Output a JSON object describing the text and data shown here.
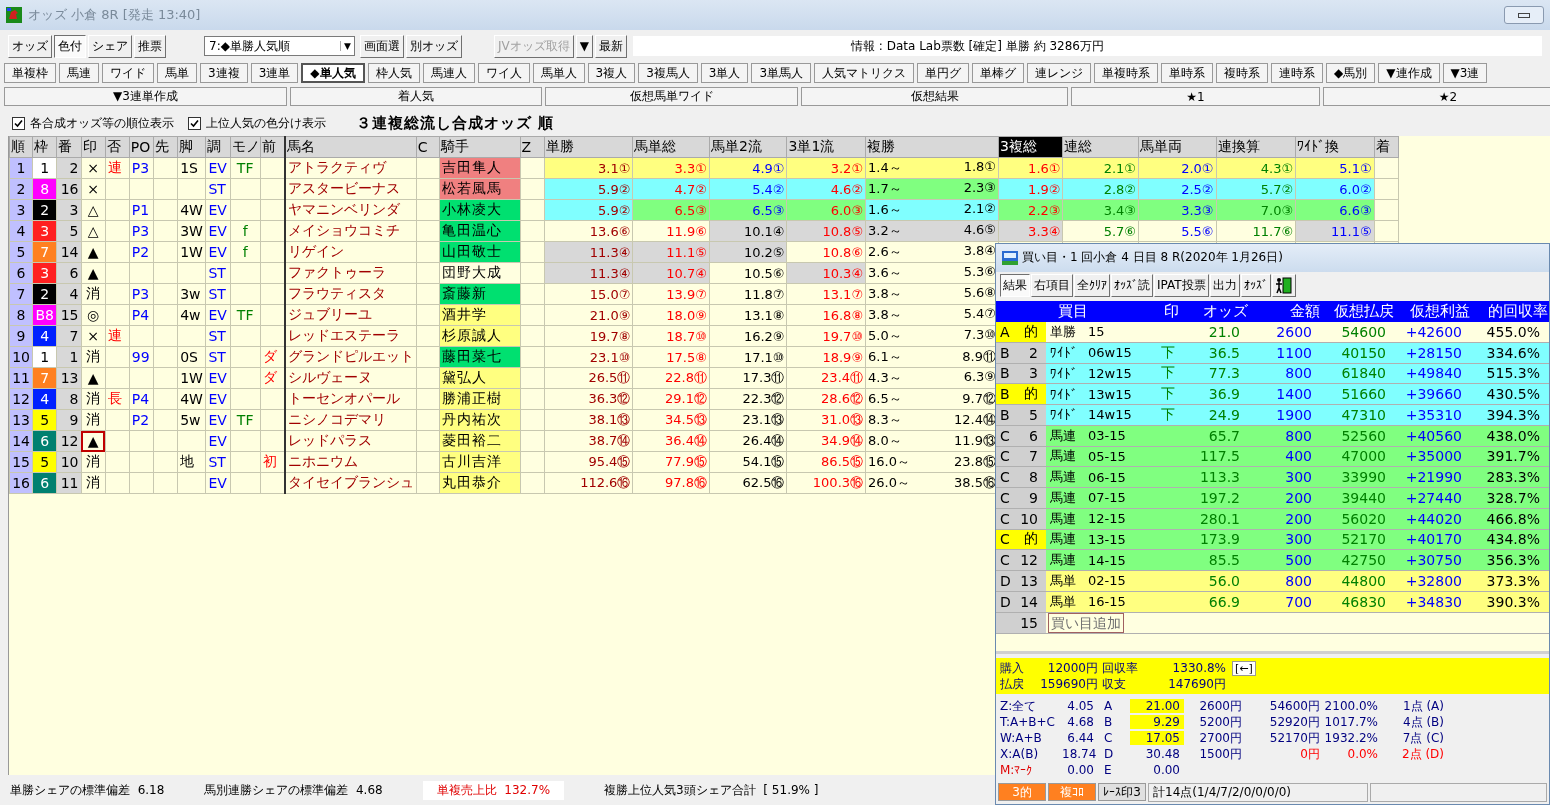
{
  "window": {
    "title": "オッズ 小倉 8R [発走 13:40]"
  },
  "toolbar": {
    "modes": [
      {
        "label": "オッズ",
        "selected": false
      },
      {
        "label": "色付",
        "selected": true
      },
      {
        "label": "シェア",
        "selected": false
      },
      {
        "label": "推票",
        "selected": false
      }
    ],
    "sort_select": {
      "value": "7:◆単勝人気順",
      "arrow": "▼"
    },
    "buttons": [
      {
        "label": "画面選",
        "disabled": false
      },
      {
        "label": "別オッズ",
        "disabled": false
      },
      {
        "label": "JVオッズ取得",
        "disabled": true
      },
      {
        "label": "▼",
        "disabled": false
      },
      {
        "label": "最新",
        "disabled": false
      }
    ],
    "info": "情報 : Data Lab票数 [確定] 単勝 約 3286万円"
  },
  "views": [
    {
      "label": "単複枠",
      "selected": false
    },
    {
      "label": "馬連",
      "selected": false
    },
    {
      "label": "ワイド",
      "selected": false
    },
    {
      "label": "馬単",
      "selected": false
    },
    {
      "label": "3連複",
      "selected": false
    },
    {
      "label": "3連単",
      "selected": false
    },
    {
      "label": "◆単人気",
      "selected": true
    },
    {
      "label": "枠人気",
      "selected": false
    },
    {
      "label": "馬連人",
      "selected": false
    },
    {
      "label": "ワイ人",
      "selected": false
    },
    {
      "label": "馬単人",
      "selected": false
    },
    {
      "label": "3複人",
      "selected": false
    },
    {
      "label": "3複馬人",
      "selected": false
    },
    {
      "label": "3単人",
      "selected": false
    },
    {
      "label": "3単馬人",
      "selected": false
    },
    {
      "label": "人気マトリクス",
      "selected": false
    },
    {
      "label": "単円グ",
      "selected": false
    },
    {
      "label": "単棒グ",
      "selected": false
    },
    {
      "label": "連レンジ",
      "selected": false
    },
    {
      "label": "単複時系",
      "selected": false
    },
    {
      "label": "単時系",
      "selected": false
    },
    {
      "label": "複時系",
      "selected": false
    },
    {
      "label": "連時系",
      "selected": false
    },
    {
      "label": "◆馬別",
      "selected": false
    },
    {
      "label": "▼連作成",
      "selected": false
    },
    {
      "label": "▼3連",
      "selected": false
    }
  ],
  "tools": [
    "▼3連単作成",
    "着人気",
    "仮想馬単ワイド",
    "仮想結果",
    "★1",
    "★2"
  ],
  "options": [
    {
      "label": "各合成オッズ等の順位表示",
      "checked": true
    },
    {
      "label": "上位人気の色分け表示",
      "checked": true
    }
  ],
  "heading": "３連複総流し合成オッズ 順",
  "table": {
    "columns": [
      {
        "label": "順",
        "selected": false
      },
      {
        "label": "枠",
        "selected": false
      },
      {
        "label": "番",
        "selected": false
      },
      {
        "label": "印",
        "selected": false
      },
      {
        "label": "否",
        "selected": false
      },
      {
        "label": "PO",
        "selected": false
      },
      {
        "label": "先",
        "selected": false
      },
      {
        "label": "脚",
        "selected": false
      },
      {
        "label": "調",
        "selected": false
      },
      {
        "label": "モノ",
        "selected": false
      },
      {
        "label": "前",
        "selected": false
      },
      {
        "label": "馬名",
        "selected": false
      },
      {
        "label": "C",
        "selected": false
      },
      {
        "label": "騎手",
        "selected": false
      },
      {
        "label": "Z",
        "selected": false
      },
      {
        "label": "単勝",
        "selected": false
      },
      {
        "label": "馬単総",
        "selected": false
      },
      {
        "label": "馬単2流",
        "selected": false
      },
      {
        "label": "3単1流",
        "selected": false
      },
      {
        "label": "複勝",
        "selected": false
      },
      {
        "label": "3複総",
        "selected": true
      },
      {
        "label": "連総",
        "selected": false
      },
      {
        "label": "馬単両",
        "selected": false
      },
      {
        "label": "連換算",
        "selected": false
      },
      {
        "label": "ﾜｲﾄﾞ換",
        "selected": false
      },
      {
        "label": "着",
        "selected": false
      }
    ],
    "rows": [
      {
        "rank": "1",
        "waku": {
          "t": "1",
          "color": "#ffffff"
        },
        "num": "2",
        "mark": "×",
        "mark_boxed": false,
        "hi": "連",
        "po": "P3",
        "leg": "1S",
        "cond": "EV",
        "mono": "TF",
        "name": "アトラクティヴ",
        "jockey": {
          "t": "吉田隼人",
          "color": "#f08080"
        },
        "odds": [
          {
            "t": "3.1①",
            "color": "#ffff80"
          },
          {
            "t": "3.3①",
            "color": "#ffff80"
          },
          {
            "t": "4.9①",
            "color": "#ffff80"
          },
          {
            "t": "3.2①",
            "color": "#ffff80"
          }
        ],
        "place": {
          "lo": "1.4～",
          "hi": "1.8①",
          "color": "#ffff80"
        },
        "more": [
          {
            "t": "1.6①",
            "color": "#ffff80"
          },
          {
            "t": "2.1①",
            "color": "#ffff80"
          },
          {
            "t": "2.0①",
            "color": "#ffff80"
          },
          {
            "t": "4.3①",
            "color": "#ffff80"
          },
          {
            "t": "5.1①",
            "color": "#ffff80"
          }
        ]
      },
      {
        "rank": "2",
        "waku": {
          "t": "8",
          "color": "#ff00ff"
        },
        "num": "16",
        "mark": "×",
        "mark_boxed": false,
        "cond": "ST",
        "name": "アスタービーナス",
        "jockey": {
          "t": "松若風馬",
          "color": "#f08080"
        },
        "odds": [
          {
            "t": "5.9②",
            "color": "#80ffff"
          },
          {
            "t": "4.7②",
            "color": "#80ffff"
          },
          {
            "t": "5.4②",
            "color": "#80ffff"
          },
          {
            "t": "4.6②",
            "color": "#80ffff"
          }
        ],
        "place": {
          "lo": "1.7～",
          "hi": "2.3③",
          "color": "#80ff80"
        },
        "more": [
          {
            "t": "1.9②",
            "color": "#80ffff"
          },
          {
            "t": "2.8②",
            "color": "#80ffff"
          },
          {
            "t": "2.5②",
            "color": "#80ffff"
          },
          {
            "t": "5.7②",
            "color": "#80ffff"
          },
          {
            "t": "6.0②",
            "color": "#80ffff"
          }
        ]
      },
      {
        "rank": "3",
        "waku": {
          "t": "2",
          "color": "#000000"
        },
        "num": "3",
        "mark": "△",
        "mark_boxed": false,
        "po": "P1",
        "leg": "4W",
        "cond": "EV",
        "name": "ヤマニンベリンダ",
        "jockey": {
          "t": "小林凌大",
          "color": "#00e070"
        },
        "odds": [
          {
            "t": "5.9②",
            "color": "#80ffff"
          },
          {
            "t": "6.5③",
            "color": "#80ff80"
          },
          {
            "t": "6.5③",
            "color": "#80ff80"
          },
          {
            "t": "6.0③",
            "color": "#80ff80"
          }
        ],
        "place": {
          "lo": "1.6～",
          "hi": "2.1②",
          "color": "#80ffff"
        },
        "more": [
          {
            "t": "2.2③",
            "color": "#80ff80"
          },
          {
            "t": "3.4③",
            "color": "#80ff80"
          },
          {
            "t": "3.3③",
            "color": "#80ff80"
          },
          {
            "t": "7.0③",
            "color": "#80ff80"
          },
          {
            "t": "6.6③",
            "color": "#80ff80"
          }
        ]
      },
      {
        "rank": "4",
        "waku": {
          "t": "3",
          "color": "#ff2020"
        },
        "num": "5",
        "mark": "△",
        "mark_boxed": false,
        "po": "P3",
        "leg": "3W",
        "cond": "EV",
        "mono": "f",
        "name": "メイショウコミチ",
        "jockey": {
          "t": "亀田温心",
          "color": "#00e070"
        },
        "odds": [
          {
            "t": "13.6⑥"
          },
          {
            "t": "11.9⑥"
          },
          {
            "t": "10.1④",
            "color": "#d8d8d8"
          },
          {
            "t": "10.8⑤",
            "color": "#d8d8d8"
          }
        ],
        "place": {
          "lo": "3.2～",
          "hi": "4.6⑤",
          "color": "#d8d8d8"
        },
        "more": [
          {
            "t": "3.3④",
            "color": "#d8d8d8"
          },
          {
            "t": "5.7⑥"
          },
          {
            "t": "5.5⑥"
          },
          {
            "t": "11.7⑥"
          },
          {
            "t": "11.1⑤",
            "color": "#d8d8d8"
          }
        ]
      },
      {
        "rank": "5",
        "waku": {
          "t": "7",
          "color": "#ff8020"
        },
        "num": "14",
        "mark": "▲",
        "mark_boxed": false,
        "po": "P2",
        "leg": "1W",
        "cond": "EV",
        "mono": "f",
        "name": "リゲイン",
        "jockey": {
          "t": "山田敬士",
          "color": "#00e070"
        },
        "odds": [
          {
            "t": "11.3④",
            "color": "#d8d8d8"
          },
          {
            "t": "11.1⑤",
            "color": "#d8d8d8"
          },
          {
            "t": "10.2⑤",
            "color": "#d8d8d8"
          },
          {
            "t": "10.8⑥"
          }
        ],
        "place": {
          "lo": "2.6～",
          "hi": "3.8④"
        }
      },
      {
        "rank": "6",
        "waku": {
          "t": "3",
          "color": "#ff2020"
        },
        "num": "6",
        "mark": "▲",
        "mark_boxed": false,
        "cond": "ST",
        "name": "ファクトゥーラ",
        "jockey": {
          "t": "団野大成"
        },
        "odds": [
          {
            "t": "11.3④",
            "color": "#d8d8d8"
          },
          {
            "t": "10.7④",
            "color": "#d8d8d8"
          },
          {
            "t": "10.5⑥"
          },
          {
            "t": "10.3④",
            "color": "#d8d8d8"
          }
        ],
        "place": {
          "lo": "3.6～",
          "hi": "5.3⑥"
        }
      },
      {
        "rank": "7",
        "waku": {
          "t": "2",
          "color": "#000000"
        },
        "num": "4",
        "mark": "消",
        "mark_boxed": false,
        "po": "P3",
        "leg": "3w",
        "cond": "ST",
        "name": "フラウティスタ",
        "jockey": {
          "t": "斎藤新",
          "color": "#00e070"
        },
        "odds": [
          {
            "t": "15.0⑦"
          },
          {
            "t": "13.9⑦"
          },
          {
            "t": "11.8⑦"
          },
          {
            "t": "13.1⑦"
          }
        ],
        "place": {
          "lo": "3.8～",
          "hi": "5.6⑧"
        }
      },
      {
        "rank": "8",
        "waku": {
          "t": "B8",
          "color": "#ff00ff"
        },
        "num": "15",
        "mark": "◎",
        "mark_boxed": false,
        "po": "P4",
        "leg": "4w",
        "cond": "EV",
        "mono": "TF",
        "name": "ジュブリーユ",
        "jockey": {
          "t": "酒井学",
          "color": "#ffff80"
        },
        "odds": [
          {
            "t": "21.0⑨"
          },
          {
            "t": "18.0⑨"
          },
          {
            "t": "13.1⑧"
          },
          {
            "t": "16.8⑧"
          }
        ],
        "place": {
          "lo": "3.8～",
          "hi": "5.4⑦"
        }
      },
      {
        "rank": "9",
        "waku": {
          "t": "4",
          "color": "#0020ff"
        },
        "num": "7",
        "mark": "×",
        "mark_boxed": false,
        "hi": "連",
        "cond": "ST",
        "name": "レッドエステーラ",
        "jockey": {
          "t": "杉原誠人",
          "color": "#ffff80"
        },
        "odds": [
          {
            "t": "19.7⑧"
          },
          {
            "t": "18.7⑩"
          },
          {
            "t": "16.2⑨"
          },
          {
            "t": "19.7⑩"
          }
        ],
        "place": {
          "lo": "5.0～",
          "hi": "7.3⑩"
        }
      },
      {
        "rank": "10",
        "waku": {
          "t": "1",
          "color": "#ffffff"
        },
        "num": "1",
        "mark": "消",
        "mark_boxed": false,
        "po": "99",
        "leg": "0S",
        "cond": "ST",
        "prev": "ダ",
        "name": "グランドピルエット",
        "jockey": {
          "t": "藤田菜七",
          "color": "#00e070"
        },
        "odds": [
          {
            "t": "23.1⑩"
          },
          {
            "t": "17.5⑧"
          },
          {
            "t": "17.1⑩"
          },
          {
            "t": "18.9⑨"
          }
        ],
        "place": {
          "lo": "6.1～",
          "hi": "8.9⑪"
        }
      },
      {
        "rank": "11",
        "waku": {
          "t": "7",
          "color": "#ff8020"
        },
        "num": "13",
        "mark": "▲",
        "mark_boxed": false,
        "leg": "1W",
        "cond": "EV",
        "prev": "ダ",
        "name": "シルヴェーヌ",
        "jockey": {
          "t": "黛弘人",
          "color": "#ffff80"
        },
        "odds": [
          {
            "t": "26.5⑪"
          },
          {
            "t": "22.8⑪"
          },
          {
            "t": "17.3⑪"
          },
          {
            "t": "23.4⑪"
          }
        ],
        "place": {
          "lo": "4.3～",
          "hi": "6.3⑨"
        }
      },
      {
        "rank": "12",
        "waku": {
          "t": "4",
          "color": "#0020ff"
        },
        "num": "8",
        "mark": "消",
        "mark_boxed": false,
        "hi": "長",
        "po": "P4",
        "leg": "4W",
        "cond": "EV",
        "name": "トーセンオパール",
        "jockey": {
          "t": "勝浦正樹",
          "color": "#ffff80"
        },
        "odds": [
          {
            "t": "36.3⑫"
          },
          {
            "t": "29.1⑫"
          },
          {
            "t": "22.3⑫"
          },
          {
            "t": "28.6⑫"
          }
        ],
        "place": {
          "lo": "6.5～",
          "hi": "9.7⑫"
        }
      },
      {
        "rank": "13",
        "waku": {
          "t": "5",
          "color": "#ffff00"
        },
        "num": "9",
        "mark": "消",
        "mark_boxed": false,
        "po": "P2",
        "leg": "5w",
        "cond": "EV",
        "mono": "TF",
        "name": "ニシノコデマリ",
        "jockey": {
          "t": "丹内祐次",
          "color": "#ffff80"
        },
        "odds": [
          {
            "t": "38.1⑬"
          },
          {
            "t": "34.5⑬"
          },
          {
            "t": "23.1⑬"
          },
          {
            "t": "31.0⑬"
          }
        ],
        "place": {
          "lo": "8.3～",
          "hi": "12.4⑭"
        }
      },
      {
        "rank": "14",
        "waku": {
          "t": "6",
          "color": "#008070"
        },
        "num": "12",
        "mark": "▲",
        "mark_boxed": true,
        "cond": "EV",
        "name": "レッドパラス",
        "jockey": {
          "t": "菱田裕二",
          "color": "#ffff80"
        },
        "odds": [
          {
            "t": "38.7⑭"
          },
          {
            "t": "36.4⑭"
          },
          {
            "t": "26.4⑭"
          },
          {
            "t": "34.9⑭"
          }
        ],
        "place": {
          "lo": "8.0～",
          "hi": "11.9⑬"
        }
      },
      {
        "rank": "15",
        "waku": {
          "t": "5",
          "color": "#ffff00"
        },
        "num": "10",
        "mark": "消",
        "mark_boxed": false,
        "leg": "地",
        "cond": "ST",
        "prev": "初",
        "name": "ニホニウム",
        "jockey": {
          "t": "古川吉洋",
          "color": "#ffff80"
        },
        "odds": [
          {
            "t": "95.4⑮"
          },
          {
            "t": "77.9⑮"
          },
          {
            "t": "54.1⑮"
          },
          {
            "t": "86.5⑮"
          }
        ],
        "place": {
          "lo": "16.0～",
          "hi": "23.8⑮"
        }
      },
      {
        "rank": "16",
        "waku": {
          "t": "6",
          "color": "#008070"
        },
        "num": "11",
        "mark": "消",
        "mark_boxed": false,
        "cond": "EV",
        "name": "タイセイブランシュ",
        "jockey": {
          "t": "丸田恭介",
          "color": "#ffff80"
        },
        "odds": [
          {
            "t": "112.6⑯"
          },
          {
            "t": "97.8⑯"
          },
          {
            "t": "62.5⑯"
          },
          {
            "t": "100.3⑯"
          }
        ],
        "place": {
          "lo": "26.0～",
          "hi": "38.5⑯"
        }
      }
    ]
  },
  "status_bar": [
    {
      "label": "単勝シェアの標準偏差",
      "value": "6.18",
      "alert": false
    },
    {
      "label": "馬別連勝シェアの標準偏差",
      "value": "4.68",
      "alert": false
    },
    {
      "label": "単複売上比",
      "value": "132.7%",
      "alert": true
    },
    {
      "label": "複勝上位人気3頭シェア合計",
      "value": "[ 51.9% ]",
      "alert": false
    }
  ],
  "bets_window": {
    "title": "買い目・1 回小倉 4 日目 8 R(2020年 1月26日)",
    "buttons": [
      {
        "label": "結果",
        "selected": true
      },
      {
        "label": "右項目",
        "selected": false
      },
      {
        "label": "全ｸﾘｱ",
        "selected": false
      },
      {
        "label": "ｵｯｽﾞ読",
        "selected": false
      },
      {
        "label": "IPAT投票",
        "selected": false
      },
      {
        "label": "出力",
        "selected": false
      },
      {
        "label": "ｵｯｽﾞ",
        "selected": false
      }
    ],
    "columns": [
      "買目",
      "印",
      "オッズ",
      "金額",
      "仮想払戻",
      "仮想利益",
      "的回収率"
    ],
    "rows": [
      {
        "group": "A",
        "no": "的",
        "hit": true,
        "type": "単勝",
        "combo": "15",
        "odds": "21.0",
        "amount": "2600",
        "payout": "54600",
        "profit": "+42600",
        "rate": "455.0%",
        "color": "#ffffe0"
      },
      {
        "group": "B",
        "no": "2",
        "hit": false,
        "type": "ﾜｲﾄﾞ",
        "combo": "06w15",
        "mark": "下",
        "odds": "36.5",
        "amount": "1100",
        "payout": "40150",
        "profit": "+28150",
        "rate": "334.6%",
        "color": "#80ffff"
      },
      {
        "group": "B",
        "no": "3",
        "hit": false,
        "type": "ﾜｲﾄﾞ",
        "combo": "12w15",
        "mark": "下",
        "odds": "77.3",
        "amount": "800",
        "payout": "61840",
        "profit": "+49840",
        "rate": "515.3%",
        "color": "#80ffff"
      },
      {
        "group": "B",
        "no": "的",
        "hit": true,
        "type": "ﾜｲﾄﾞ",
        "combo": "13w15",
        "mark": "下",
        "odds": "36.9",
        "amount": "1400",
        "payout": "51660",
        "profit": "+39660",
        "rate": "430.5%",
        "color": "#80ffff"
      },
      {
        "group": "B",
        "no": "5",
        "hit": false,
        "type": "ﾜｲﾄﾞ",
        "combo": "14w15",
        "mark": "下",
        "odds": "24.9",
        "amount": "1900",
        "payout": "47310",
        "profit": "+35310",
        "rate": "394.3%",
        "color": "#80ffff"
      },
      {
        "group": "C",
        "no": "6",
        "hit": false,
        "type": "馬連",
        "combo": "03-15",
        "odds": "65.7",
        "amount": "800",
        "payout": "52560",
        "profit": "+40560",
        "rate": "438.0%",
        "color": "#80ff80"
      },
      {
        "group": "C",
        "no": "7",
        "hit": false,
        "type": "馬連",
        "combo": "05-15",
        "odds": "117.5",
        "amount": "400",
        "payout": "47000",
        "profit": "+35000",
        "rate": "391.7%",
        "color": "#80ff80"
      },
      {
        "group": "C",
        "no": "8",
        "hit": false,
        "type": "馬連",
        "combo": "06-15",
        "odds": "113.3",
        "amount": "300",
        "payout": "33990",
        "profit": "+21990",
        "rate": "283.3%",
        "color": "#80ff80"
      },
      {
        "group": "C",
        "no": "9",
        "hit": false,
        "type": "馬連",
        "combo": "07-15",
        "odds": "197.2",
        "amount": "200",
        "payout": "39440",
        "profit": "+27440",
        "rate": "328.7%",
        "color": "#80ff80"
      },
      {
        "group": "C",
        "no": "10",
        "hit": false,
        "type": "馬連",
        "combo": "12-15",
        "odds": "280.1",
        "amount": "200",
        "payout": "56020",
        "profit": "+44020",
        "rate": "466.8%",
        "color": "#80ff80"
      },
      {
        "group": "C",
        "no": "的",
        "hit": true,
        "type": "馬連",
        "combo": "13-15",
        "odds": "173.9",
        "amount": "300",
        "payout": "52170",
        "profit": "+40170",
        "rate": "434.8%",
        "color": "#80ff80"
      },
      {
        "group": "C",
        "no": "12",
        "hit": false,
        "type": "馬連",
        "combo": "14-15",
        "odds": "85.5",
        "amount": "500",
        "payout": "42750",
        "profit": "+30750",
        "rate": "356.3%",
        "color": "#80ff80"
      },
      {
        "group": "D",
        "no": "13",
        "hit": false,
        "type": "馬単",
        "combo": "02-15",
        "odds": "56.0",
        "amount": "800",
        "payout": "44800",
        "profit": "+32800",
        "rate": "373.3%",
        "color": "#ffff80"
      },
      {
        "group": "D",
        "no": "14",
        "hit": false,
        "type": "馬単",
        "combo": "16-15",
        "odds": "66.9",
        "amount": "700",
        "payout": "46830",
        "profit": "+34830",
        "rate": "390.3%",
        "color": "#ffff80"
      }
    ],
    "add_row": {
      "no": "15",
      "label": "買い目追加"
    },
    "summary": [
      {
        "label": "購入",
        "value": "12000円",
        "label2": "回収率",
        "value2": "1330.8%"
      },
      {
        "label": "払戻",
        "value": "159690円",
        "label2": "収支",
        "value2": "147690円"
      }
    ],
    "back": "[←]",
    "stats": [
      {
        "name": "Z:全て",
        "v": "4.05",
        "g": "A",
        "gv": "21.00",
        "hl": true,
        "amt": "2600円",
        "pay": "54600円",
        "rate": "2100.0%",
        "pts": "1点 (A)",
        "loss": false
      },
      {
        "name": "T:A+B+C",
        "v": "4.68",
        "g": "B",
        "gv": "9.29",
        "hl": true,
        "amt": "5200円",
        "pay": "52920円",
        "rate": "1017.7%",
        "pts": "4点 (B)",
        "loss": false
      },
      {
        "name": "W:A+B",
        "v": "6.44",
        "g": "C",
        "gv": "17.05",
        "hl": true,
        "amt": "2700円",
        "pay": "52170円",
        "rate": "1932.2%",
        "pts": "7点 (C)",
        "loss": false
      },
      {
        "name": "X:A(B)",
        "v": "18.74",
        "g": "D",
        "gv": "30.48",
        "hl": false,
        "amt": "1500円",
        "pay": "0円",
        "rate": "0.0%",
        "pts": "2点 (D)",
        "loss": true
      },
      {
        "name": "M:ﾏｰｸ",
        "v": "0.00",
        "g": "E",
        "gv": "0.00",
        "hl": false
      }
    ],
    "tabs": [
      {
        "label": "3的",
        "selected": true
      },
      {
        "label": "複ｺﾛ",
        "selected": true
      },
      {
        "label": "ﾚｰｽ印3",
        "selected": false
      }
    ],
    "total": "計14点(1/4/7/2/0/0/0/0)"
  }
}
